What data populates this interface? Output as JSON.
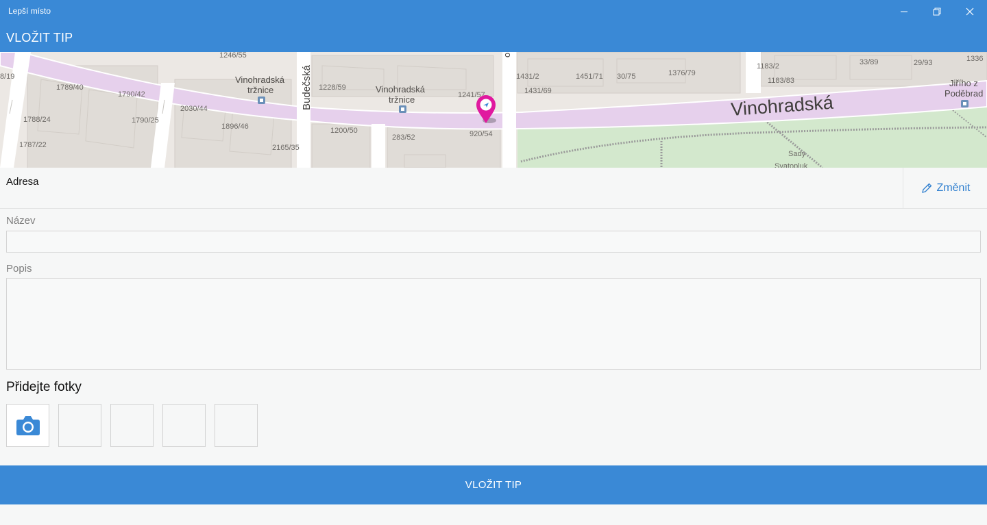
{
  "window": {
    "title": "Lepší místo"
  },
  "header": {
    "title": "VLOŽIT TIP"
  },
  "map": {
    "street_main": "Vinohradská",
    "street_side": "Budečská",
    "street_partial": "o",
    "poi_1": "Vinohradská",
    "poi_1b": "tržnice",
    "poi_2": "Vinohradská",
    "poi_2b": "tržnice",
    "poi_3": "Jiřího z",
    "poi_3b": "Poděbrad",
    "park": "Sady",
    "park_b": "Svatopluk",
    "pin_color": "#e0199f",
    "road_color": "#e6d0ec",
    "park_color": "#d3e8cd",
    "house_numbers": [
      "1246/55",
      "1789/40",
      "1790/42",
      "2030/44",
      "1790/25",
      "1788/24",
      "1896/46",
      "1787/22",
      "2165/35",
      "1228/59",
      "1200/50",
      "283/52",
      "1241/57",
      "920/54",
      "1431/2",
      "1431/69",
      "1451/71",
      "30/75",
      "1376/79",
      "1183/2",
      "1183/83",
      "33/89",
      "29/93",
      "1336",
      "8/19"
    ]
  },
  "address": {
    "label": "Adresa",
    "change_label": "Změnit"
  },
  "form": {
    "name_label": "Název",
    "name_value": "",
    "description_label": "Popis",
    "description_value": ""
  },
  "photos": {
    "title": "Přidejte fotky",
    "slots": 4
  },
  "submit": {
    "label": "VLOŽIT TIP"
  },
  "colors": {
    "accent": "#3a89d6",
    "link": "#2f7fcf"
  }
}
